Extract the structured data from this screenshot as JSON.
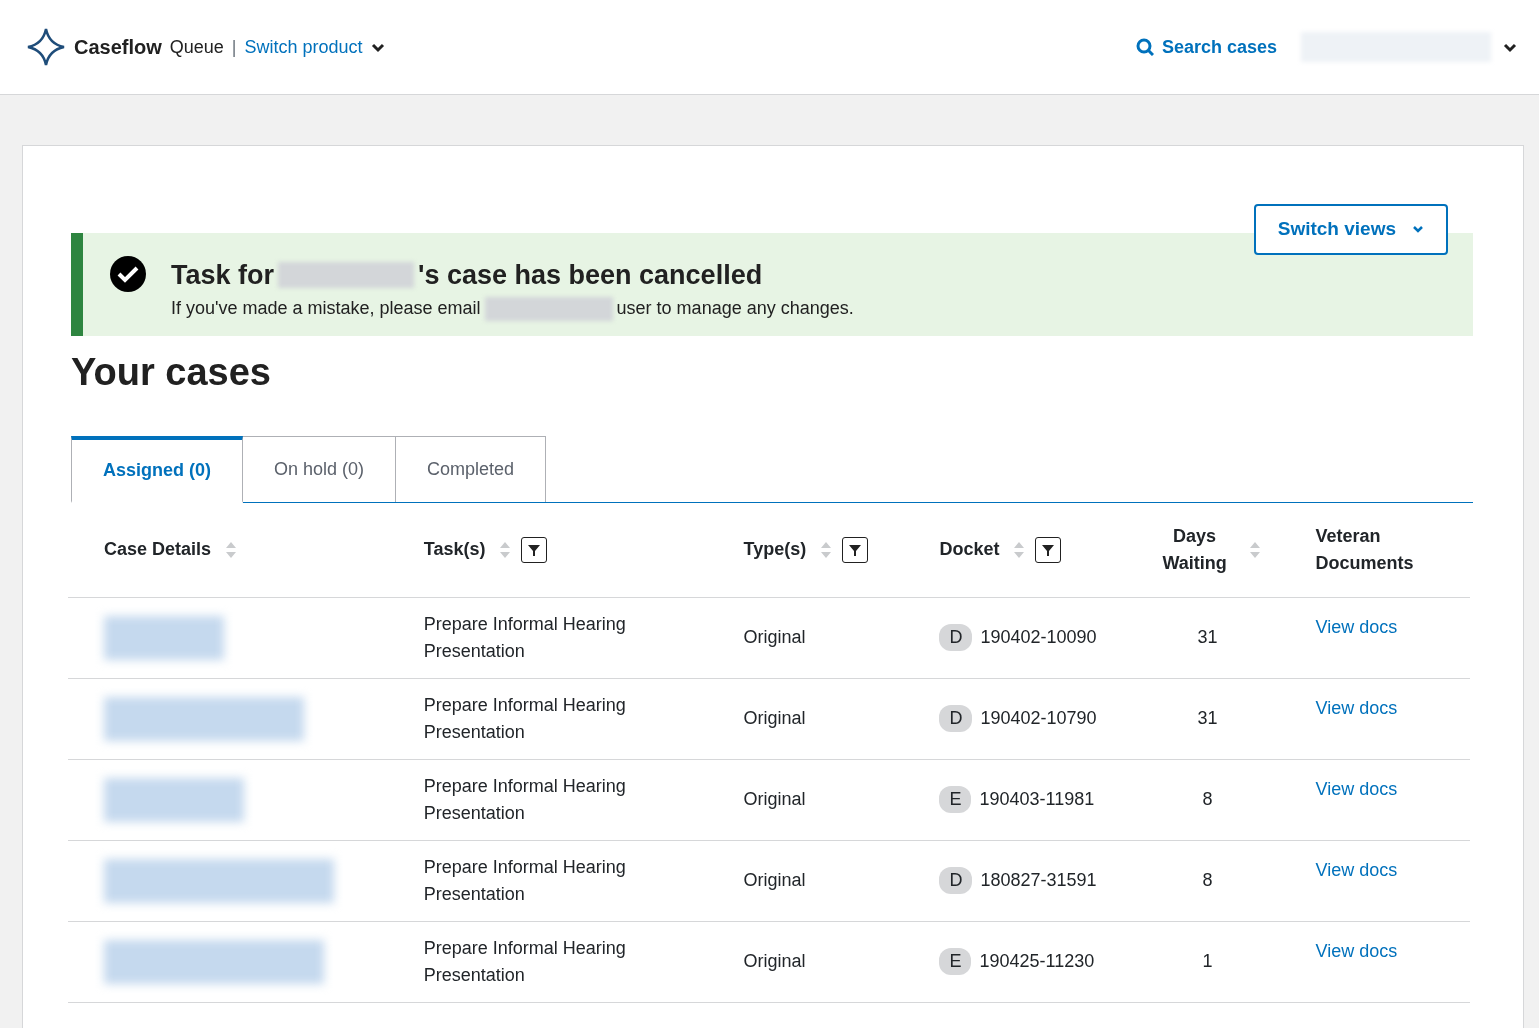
{
  "header": {
    "brand": "Caseflow",
    "product": "Queue",
    "separator": "|",
    "switch_product": "Switch product",
    "search": "Search cases"
  },
  "alert": {
    "kind": "success",
    "title_before": "Task for",
    "title_after": "'s case has been cancelled",
    "message_before": "If you've made a mistake, please email",
    "message_after": "user to manage any changes."
  },
  "switch_views": "Switch views",
  "heading": "Your cases",
  "tabs": [
    {
      "label": "Assigned (0)",
      "selected": true
    },
    {
      "label": "On hold (0)",
      "selected": false
    },
    {
      "label": "Completed",
      "selected": false
    }
  ],
  "table": {
    "columns": [
      {
        "label": "Case Details",
        "sortable": true,
        "filterable": false
      },
      {
        "label": "Task(s)",
        "sortable": true,
        "filterable": true
      },
      {
        "label": "Type(s)",
        "sortable": true,
        "filterable": true
      },
      {
        "label": "Docket",
        "sortable": true,
        "filterable": true
      },
      {
        "label": "Days Waiting",
        "sortable": true,
        "filterable": false
      },
      {
        "label": "Veteran Documents",
        "sortable": false,
        "filterable": false
      }
    ],
    "rows": [
      {
        "task": "Prepare Informal Hearing Presentation",
        "type": "Original",
        "docket_type": "D",
        "docket_number": "190402-10090",
        "days_waiting": "31",
        "documents": "View docs"
      },
      {
        "task": "Prepare Informal Hearing Presentation",
        "type": "Original",
        "docket_type": "D",
        "docket_number": "190402-10790",
        "days_waiting": "31",
        "documents": "View docs"
      },
      {
        "task": "Prepare Informal Hearing Presentation",
        "type": "Original",
        "docket_type": "E",
        "docket_number": "190403-11981",
        "days_waiting": "8",
        "documents": "View docs"
      },
      {
        "task": "Prepare Informal Hearing Presentation",
        "type": "Original",
        "docket_type": "D",
        "docket_number": "180827-31591",
        "days_waiting": "8",
        "documents": "View docs"
      },
      {
        "task": "Prepare Informal Hearing Presentation",
        "type": "Original",
        "docket_type": "E",
        "docket_number": "190425-11230",
        "days_waiting": "1",
        "documents": "View docs"
      }
    ]
  }
}
